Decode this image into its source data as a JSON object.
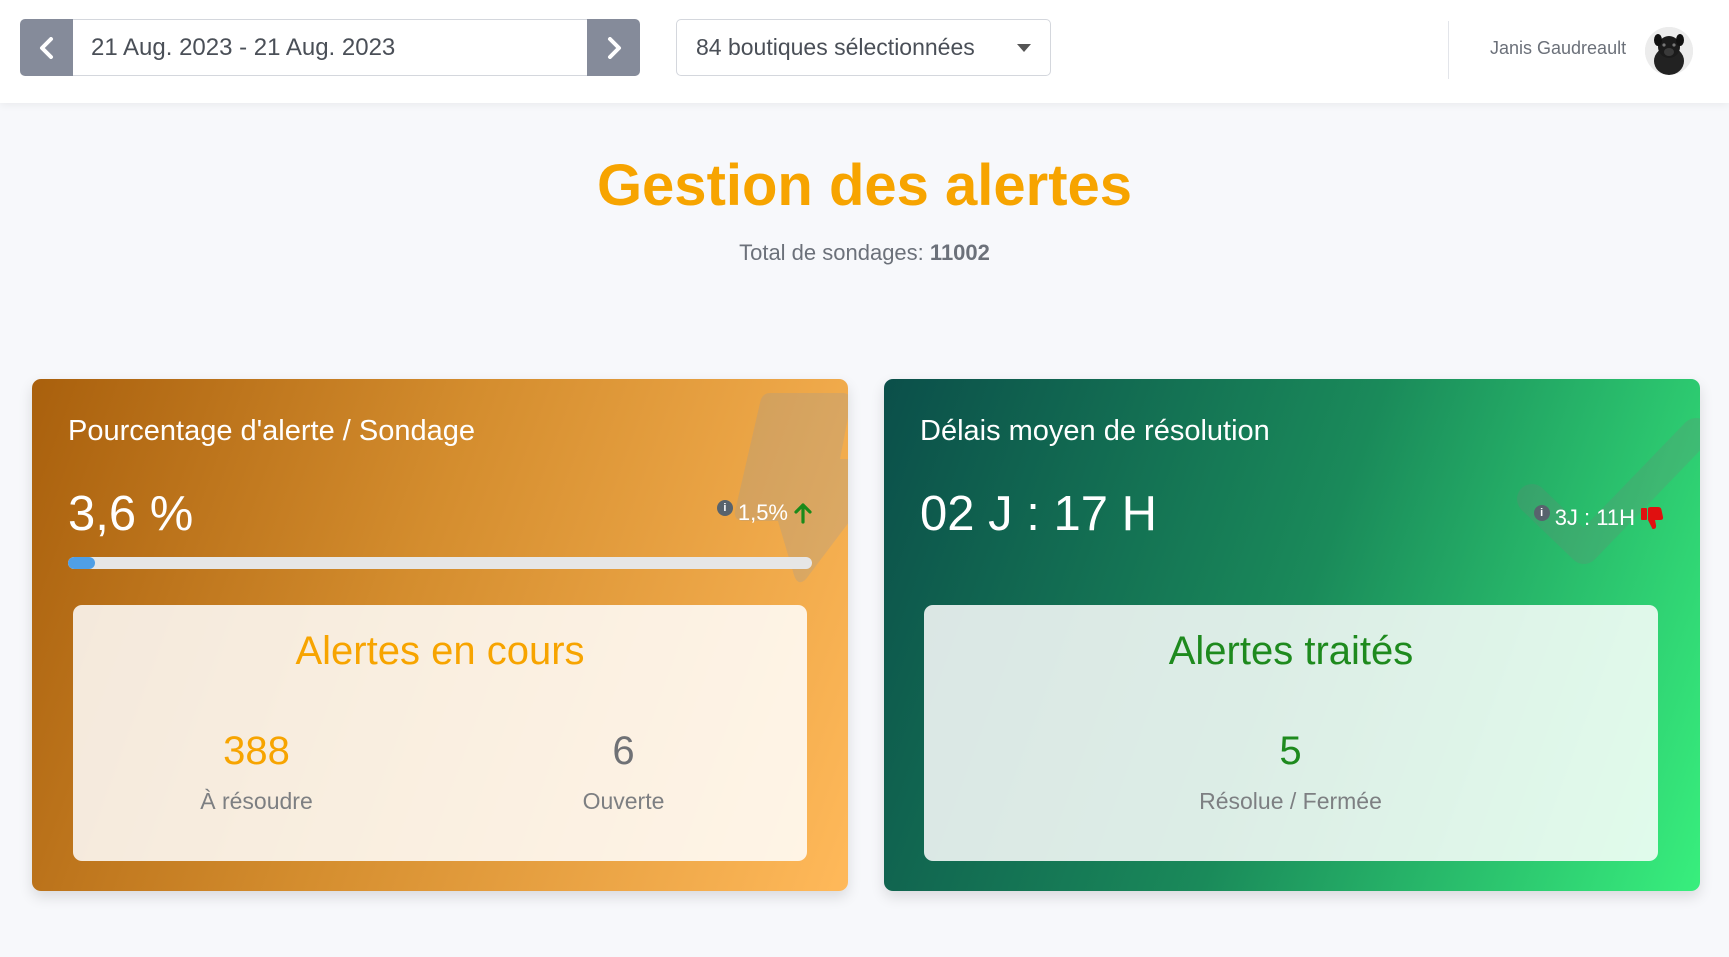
{
  "topbar": {
    "date_range": "21 Aug. 2023 - 21 Aug. 2023",
    "store_selection": "84 boutiques sélectionnées",
    "user_name": "Janis Gaudreault"
  },
  "page": {
    "title": "Gestion des alertes",
    "subtitle_label": "Total de sondages:",
    "subtitle_value": "11002"
  },
  "card_alert_rate": {
    "title": "Pourcentage d'alerte / Sondage",
    "value": "3,6 %",
    "trend": "1,5%",
    "trend_direction": "up",
    "progress_percent": 3.6,
    "inner_title": "Alertes en cours",
    "stats": [
      {
        "number": "388",
        "label": "À résoudre"
      },
      {
        "number": "6",
        "label": "Ouverte"
      }
    ],
    "colors": {
      "accent": "#f7a400",
      "trend_icon": "#1a8a1a",
      "progress": "#4f9fe6"
    }
  },
  "card_resolution": {
    "title": "Délais moyen de résolution",
    "value": "02 J : 17 H",
    "trend": "3J : 11H",
    "trend_icon": "thumbs-down-icon",
    "inner_title": "Alertes traités",
    "stats": [
      {
        "number": "5",
        "label": "Résolue / Fermée"
      }
    ],
    "colors": {
      "accent": "#1e8a1e",
      "trend_icon": "#e01010"
    }
  }
}
